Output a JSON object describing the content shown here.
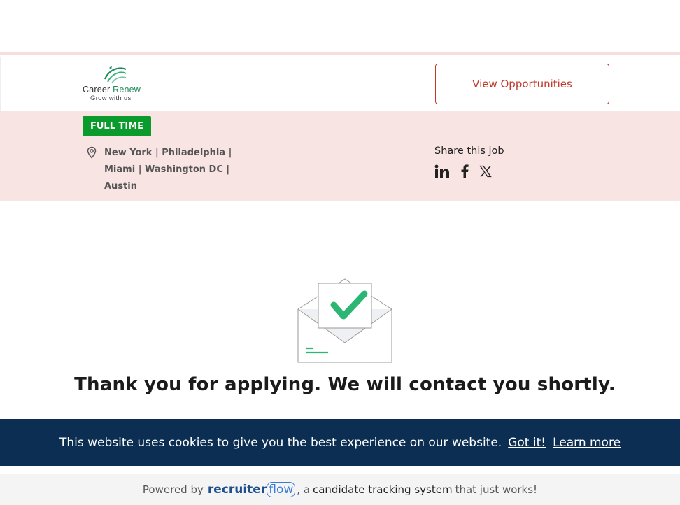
{
  "header": {
    "logo": {
      "name": "Career",
      "accent": "Renew",
      "tagline": "Grow with us"
    },
    "view_button": "View Opportunities"
  },
  "job": {
    "employment_type": "FULL TIME",
    "location": "New York | Philadelphia | Miami | Washington DC | Austin",
    "share_label": "Share this job",
    "share_icons": [
      "linkedin-icon",
      "facebook-icon",
      "x-icon"
    ]
  },
  "confirmation": {
    "message": "Thank you for applying. We will contact you shortly."
  },
  "cookie_banner": {
    "message": "This website uses cookies to give you the best experience on our website.",
    "got_it": "Got it!",
    "learn_more": "Learn more"
  },
  "footer": {
    "powered_by": "Powered by",
    "brand_main": "recruiter",
    "brand_accent": "flow",
    "connector": ", a",
    "product": "candidate tracking system",
    "tail": "that just works!"
  },
  "colors": {
    "accent_red": "#c0392b",
    "badge_green": "#0a9b2c",
    "band_pink": "#f9e4e4",
    "cookie_navy": "#0b2e52",
    "check_green": "#2bb673"
  }
}
